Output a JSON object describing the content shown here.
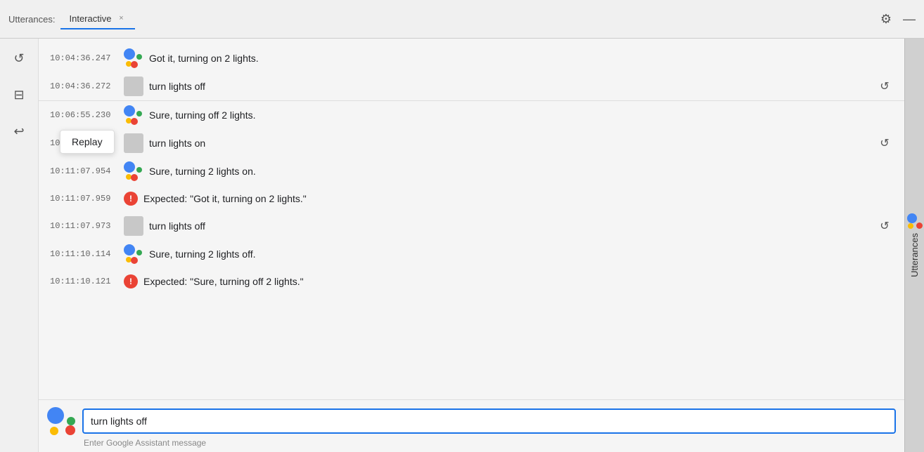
{
  "titleBar": {
    "label": "Utterances:",
    "tab": {
      "name": "Interactive",
      "closeLabel": "×"
    },
    "settingsIcon": "⚙",
    "minimizeIcon": "—"
  },
  "sidebar": {
    "icons": [
      {
        "name": "replay-icon",
        "glyph": "↺"
      },
      {
        "name": "save-icon",
        "glyph": "⊟"
      },
      {
        "name": "undo-icon",
        "glyph": "↩"
      }
    ]
  },
  "tooltip": {
    "label": "Replay"
  },
  "utterances": [
    {
      "id": "u1",
      "timestamp": "10:04:36.247",
      "avatarType": "ga",
      "text": "Got it, turning on 2 lights.",
      "hasReplay": false
    },
    {
      "id": "u2",
      "timestamp": "10:04:36.272",
      "avatarType": "user",
      "text": "turn lights off",
      "hasReplay": true
    },
    {
      "id": "u3",
      "timestamp": "10:06:55.230",
      "avatarType": "ga",
      "text": "Sure, turning off 2 lights.",
      "hasReplay": false
    },
    {
      "id": "u4",
      "timestamp": "10:11:05.826",
      "avatarType": "user",
      "text": "turn lights on",
      "hasReplay": true
    },
    {
      "id": "u5",
      "timestamp": "10:11:07.954",
      "avatarType": "ga",
      "text": "Sure, turning 2 lights on.",
      "hasReplay": false
    },
    {
      "id": "u6",
      "timestamp": "10:11:07.959",
      "avatarType": "error",
      "text": "Expected: \"Got it, turning on 2 lights.\"",
      "hasReplay": false
    },
    {
      "id": "u7",
      "timestamp": "10:11:07.973",
      "avatarType": "user",
      "text": "turn lights off",
      "hasReplay": true
    },
    {
      "id": "u8",
      "timestamp": "10:11:10.114",
      "avatarType": "ga",
      "text": "Sure, turning 2 lights off.",
      "hasReplay": false
    },
    {
      "id": "u9",
      "timestamp": "10:11:10.121",
      "avatarType": "error",
      "text": "Expected: \"Sure, turning off 2 lights.\"",
      "hasReplay": false
    }
  ],
  "inputArea": {
    "value": "turn lights off",
    "placeholder": "Enter Google Assistant message",
    "hint": "Enter Google Assistant message"
  },
  "rightSidebar": {
    "label": "Utterances"
  }
}
